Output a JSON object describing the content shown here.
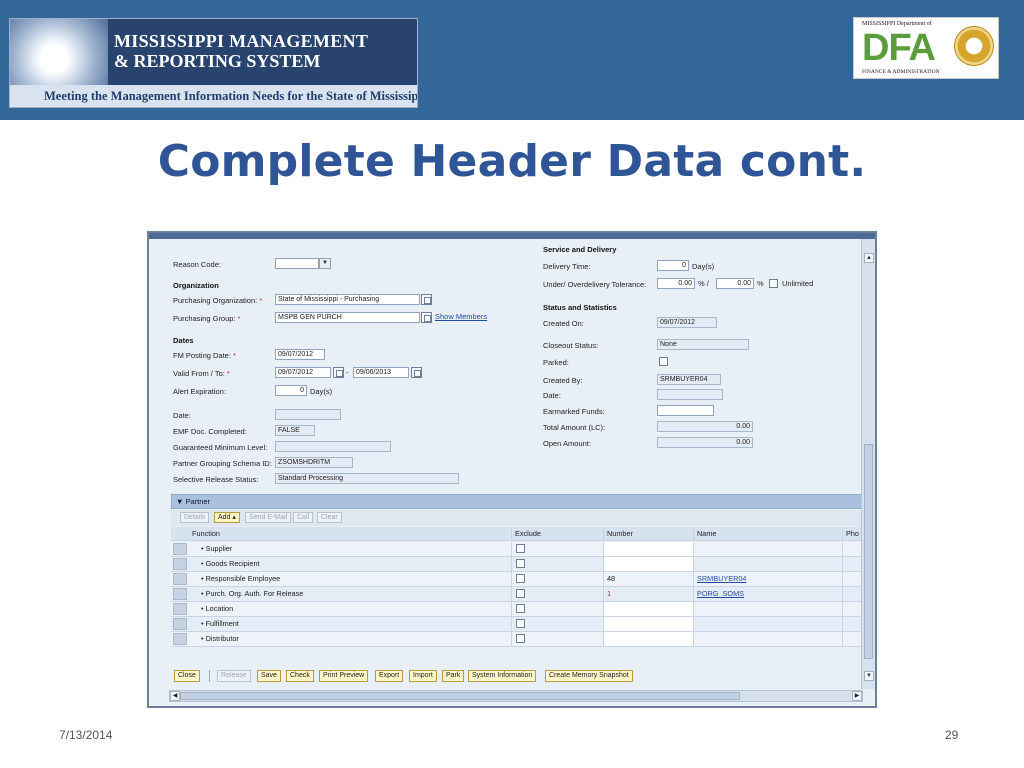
{
  "header": {
    "mmrs_line1": "MISSISSIPPI MANAGEMENT",
    "mmrs_line2": "& REPORTING SYSTEM",
    "mmrs_tagline": "Meeting the Management Information Needs for the State of Mississippi",
    "dfa_top": "MISSISSIPPI Department of",
    "dfa_text": "DFA",
    "dfa_bottom": "FINANCE & ADMINISTRATION"
  },
  "slide_title": "Complete Header Data cont.",
  "form": {
    "reason_code_label": "Reason Code:",
    "organization_heading": "Organization",
    "purch_org_label": "Purchasing Organization:",
    "purch_org_value": "State of Mississippi - Purchasing",
    "purch_group_label": "Purchasing Group:",
    "purch_group_value": "MSPB GEN PURCH",
    "show_members": "Show Members",
    "dates_heading": "Dates",
    "fm_posting_label": "FM Posting Date:",
    "fm_posting_value": "09/07/2012",
    "valid_label": "Valid From / To:",
    "valid_from": "09/07/2012",
    "valid_sep": "-",
    "valid_to": "09/06/2013",
    "alert_label": "Alert Expiration:",
    "alert_value": "0",
    "alert_unit": "Day(s)",
    "date_label": "Date:",
    "emf_label": "EMF Doc. Completed:",
    "emf_value": "FALSE",
    "gml_label": "Guaranteed Minimum Level:",
    "pgs_label": "Partner Grouping Schema ID:",
    "pgs_value": "ZSOMSHDRITM",
    "srs_label": "Selective Release Status:",
    "srs_value": "Standard Processing",
    "required_mark": "*"
  },
  "right": {
    "service_heading": "Service and Delivery",
    "delivery_time_label": "Delivery Time:",
    "delivery_time_value": "0",
    "delivery_time_unit": "Day(s)",
    "tolerance_label": "Under/ Overdelivery Tolerance:",
    "tol_under": "0.00",
    "tol_pct1": "% /",
    "tol_over": "0.00",
    "tol_pct2": "%",
    "unlimited_label": "Unlimited",
    "status_heading": "Status and Statistics",
    "created_on_label": "Created On:",
    "created_on_value": "09/07/2012",
    "closeout_label": "Closeout Status:",
    "closeout_value": "None",
    "parked_label": "Parked:",
    "created_by_label": "Created By:",
    "created_by_value": "SRMBUYER04",
    "date_label": "Date:",
    "earmarked_label": "Earmarked Funds:",
    "total_label": "Total Amount (LC):",
    "total_value": "0.00",
    "open_label": "Open Amount:",
    "open_value": "0.00"
  },
  "partner": {
    "title": "▼ Partner",
    "toolbar": [
      "Details",
      "Add ▴",
      "Send E-Mail",
      "Call",
      "Clear"
    ],
    "columns": [
      "Function",
      "Exclude",
      "Number",
      "Name",
      "Pho"
    ],
    "rows": [
      {
        "function": "• Supplier",
        "number": "",
        "name": ""
      },
      {
        "function": "• Goods Recipient",
        "number": "",
        "name": ""
      },
      {
        "function": "• Responsible Employee",
        "number": "48",
        "name": "SRMBUYER04"
      },
      {
        "function": "• Purch. Org. Auth. For Release",
        "number": "1",
        "name": "PORG_SOMS"
      },
      {
        "function": "• Location",
        "number": "",
        "name": ""
      },
      {
        "function": "• Fulfillment",
        "number": "",
        "name": ""
      },
      {
        "function": "• Distributor",
        "number": "",
        "name": ""
      }
    ]
  },
  "bottom_buttons": [
    "Close",
    "Release",
    "Save",
    "Check",
    "Print Preview",
    "Export",
    "Import",
    "Park",
    "System Information",
    "Create Memory Snapshot"
  ],
  "footer": {
    "date": "7/13/2014",
    "page": "29"
  }
}
